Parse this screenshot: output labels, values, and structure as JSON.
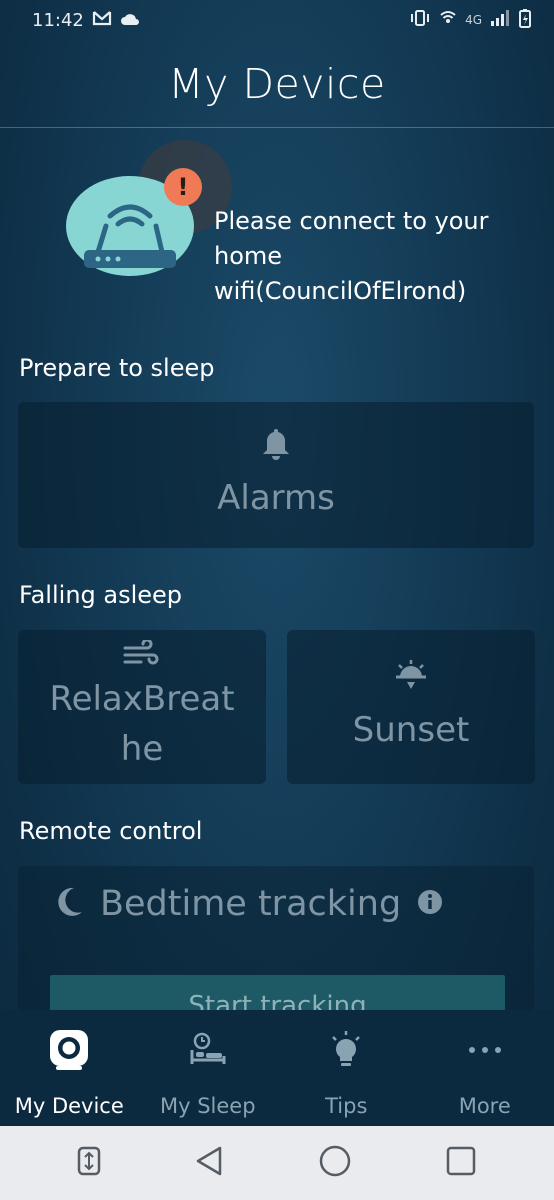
{
  "status_bar": {
    "time": "11:42",
    "network_label": "4G"
  },
  "header": {
    "title": "My Device"
  },
  "connect_banner": {
    "message": "Please connect to your home wifi(CouncilOfElrond)",
    "alert_symbol": "!"
  },
  "sections": {
    "prepare": "Prepare to sleep",
    "falling": "Falling asleep",
    "remote": "Remote control"
  },
  "cards": {
    "alarms": {
      "label": "Alarms",
      "icon": "bell-icon"
    },
    "relax": {
      "label": "RelaxBreat\nhe",
      "icon": "wind-icon"
    },
    "sunset": {
      "label": "Sunset",
      "icon": "sunset-icon"
    }
  },
  "bedtime": {
    "label": "Bedtime tracking",
    "icon": "moon-icon",
    "info_icon": "info-icon",
    "button_label": "Start tracking"
  },
  "bottom_nav": {
    "items": [
      {
        "label": "My Device",
        "icon": "device-icon",
        "active": true
      },
      {
        "label": "My Sleep",
        "icon": "sleep-icon",
        "active": false
      },
      {
        "label": "Tips",
        "icon": "lightbulb-icon",
        "active": false
      },
      {
        "label": "More",
        "icon": "more-icon",
        "active": false
      }
    ]
  },
  "colors": {
    "background": "#143c57",
    "card": "#0c2a3f",
    "router_circle": "#88d6d4",
    "alert": "#ef7a55",
    "button": "#1e5a66"
  }
}
